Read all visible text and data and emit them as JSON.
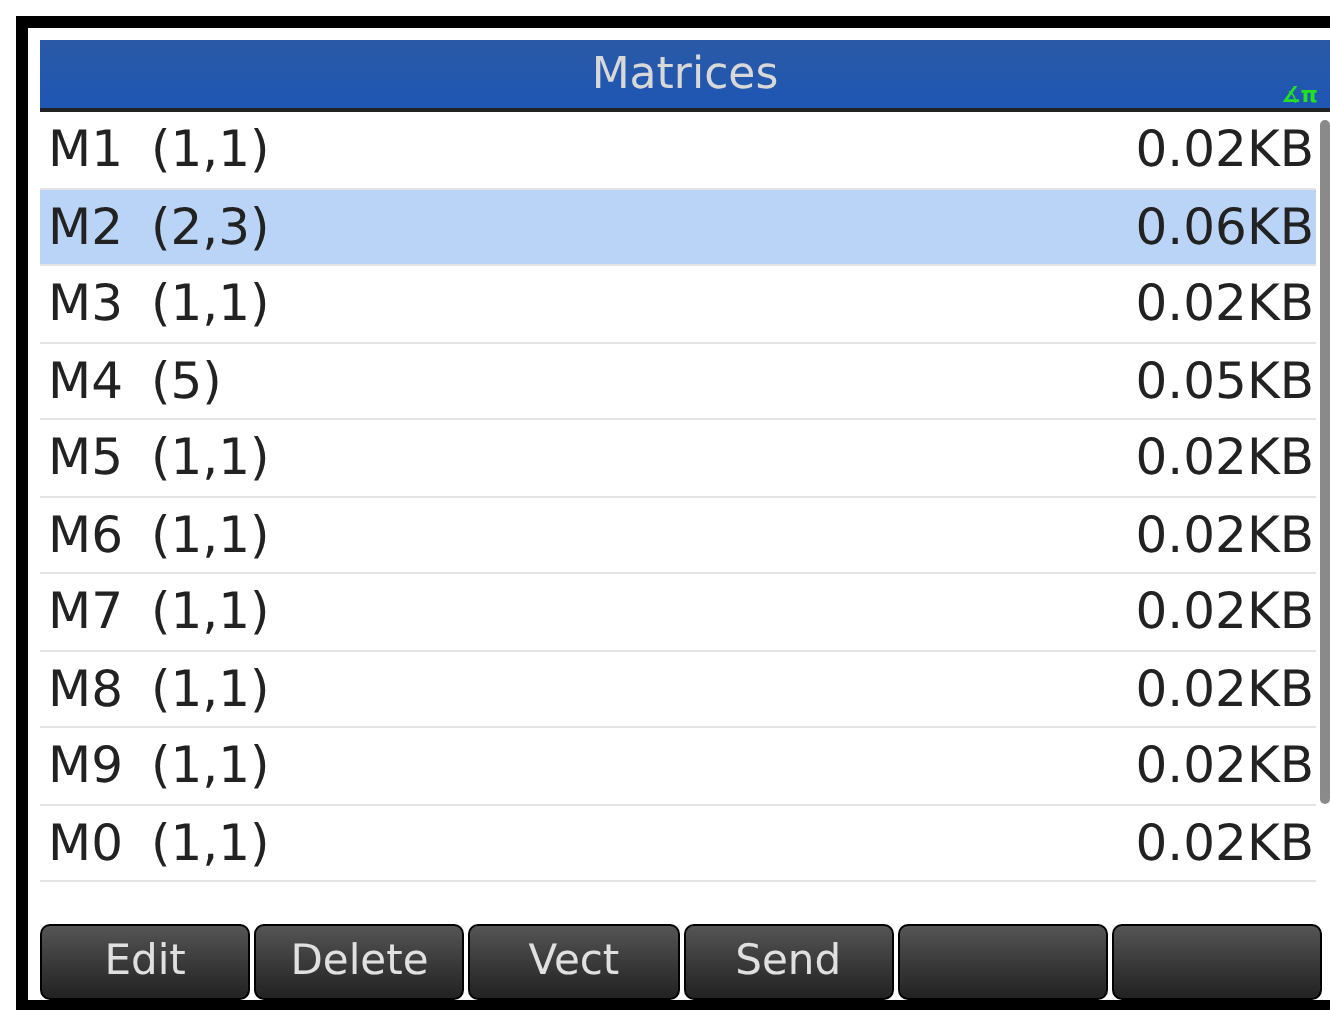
{
  "title": "Matrices",
  "angle_indicator": "∡π",
  "rows": [
    {
      "name": "M1",
      "size": "(1,1)",
      "memory": "0.02KB",
      "selected": false
    },
    {
      "name": "M2",
      "size": "(2,3)",
      "memory": "0.06KB",
      "selected": true
    },
    {
      "name": "M3",
      "size": "(1,1)",
      "memory": "0.02KB",
      "selected": false
    },
    {
      "name": "M4",
      "size": "(5)",
      "memory": "0.05KB",
      "selected": false
    },
    {
      "name": "M5",
      "size": "(1,1)",
      "memory": "0.02KB",
      "selected": false
    },
    {
      "name": "M6",
      "size": "(1,1)",
      "memory": "0.02KB",
      "selected": false
    },
    {
      "name": "M7",
      "size": "(1,1)",
      "memory": "0.02KB",
      "selected": false
    },
    {
      "name": "M8",
      "size": "(1,1)",
      "memory": "0.02KB",
      "selected": false
    },
    {
      "name": "M9",
      "size": "(1,1)",
      "memory": "0.02KB",
      "selected": false
    },
    {
      "name": "M0",
      "size": "(1,1)",
      "memory": "0.02KB",
      "selected": false
    }
  ],
  "soft_keys": [
    {
      "kind": "label",
      "label": "Edit"
    },
    {
      "kind": "label",
      "label": "Delete"
    },
    {
      "kind": "label",
      "label": "Vect"
    },
    {
      "kind": "label",
      "label": "Send"
    },
    {
      "kind": "blank"
    },
    {
      "kind": "blank"
    }
  ]
}
